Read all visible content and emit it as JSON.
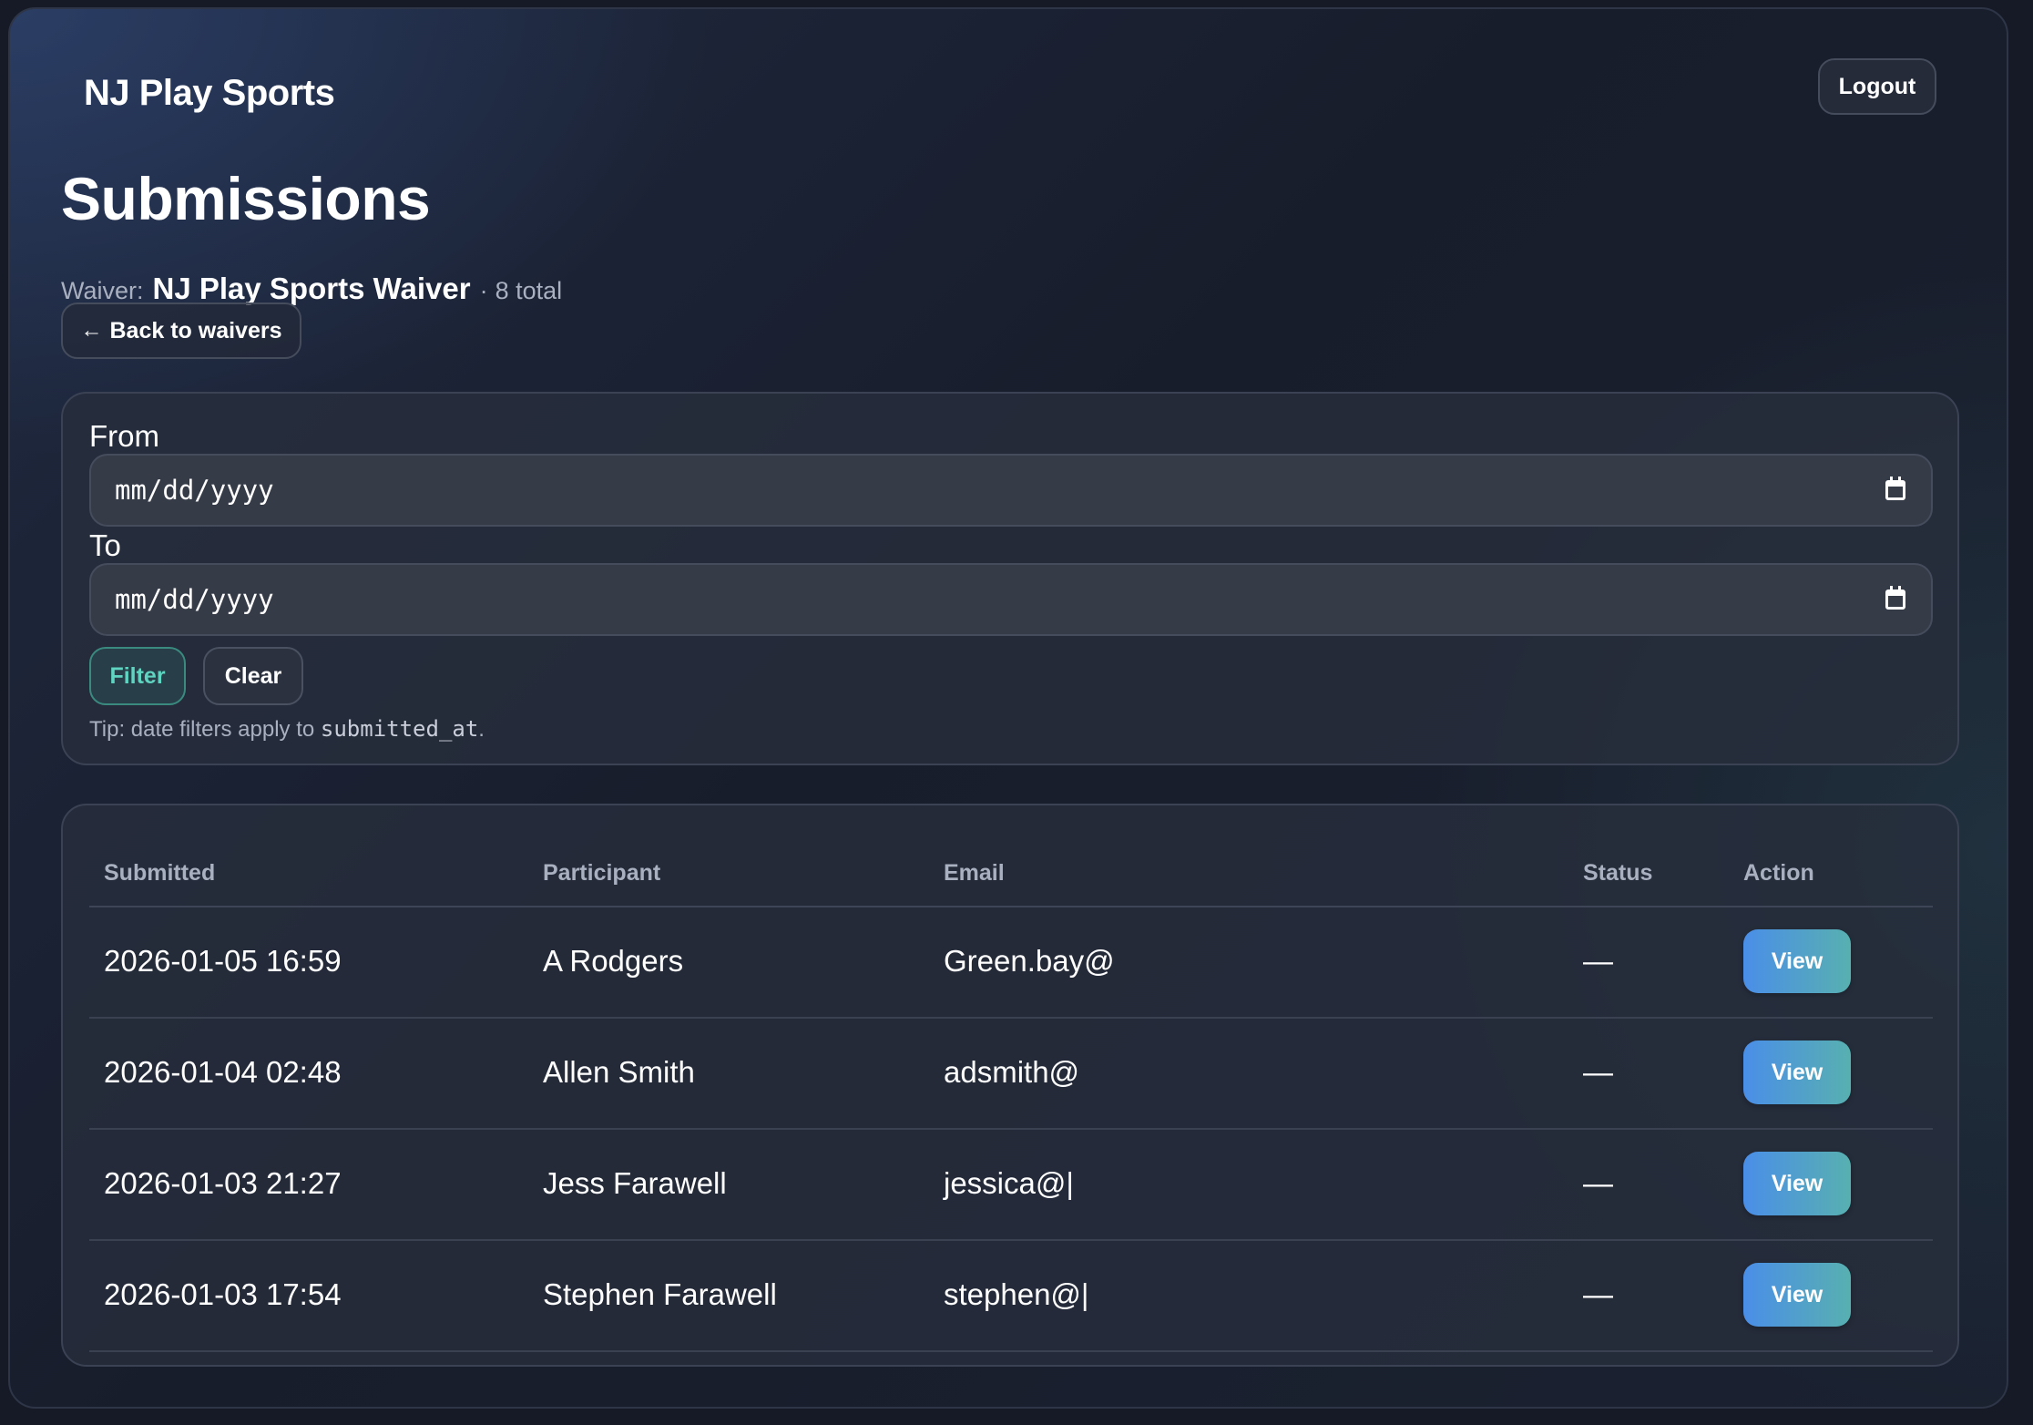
{
  "header": {
    "brand": "NJ Play Sports",
    "logout_label": "Logout"
  },
  "page": {
    "title": "Submissions",
    "waiver_label": "Waiver:",
    "waiver_name": "NJ Play Sports Waiver",
    "separator": "·",
    "total_text": "8 total",
    "back_label": "Back to waivers",
    "back_icon": "arrow-left-icon"
  },
  "filters": {
    "from_label": "From",
    "from_placeholder": "mm/dd/yyyy",
    "to_label": "To",
    "to_placeholder": "mm/dd/yyyy",
    "calendar_icon": "calendar-icon",
    "filter_label": "Filter",
    "clear_label": "Clear",
    "tip_prefix": "Tip: date filters apply to ",
    "tip_code": "submitted_at",
    "tip_suffix": "."
  },
  "table": {
    "columns": [
      "Submitted",
      "Participant",
      "Email",
      "Status",
      "Action"
    ],
    "rows": [
      {
        "submitted": "2026-01-05 16:59",
        "participant": "A Rodgers",
        "email": "Green.bay@",
        "status": "—",
        "action": "View"
      },
      {
        "submitted": "2026-01-04 02:48",
        "participant": "Allen Smith",
        "email": "adsmith@",
        "status": "—",
        "action": "View"
      },
      {
        "submitted": "2026-01-03 21:27",
        "participant": "Jess Farawell",
        "email": "jessica@|",
        "status": "—",
        "action": "View"
      },
      {
        "submitted": "2026-01-03 17:54",
        "participant": "Stephen Farawell",
        "email": "stephen@|",
        "status": "—",
        "action": "View"
      }
    ]
  },
  "colors": {
    "accent_gradient_start": "#4a8ee8",
    "accent_gradient_end": "#58b0b0",
    "filter_text": "#5fd4c0",
    "background": "#1b2130"
  }
}
